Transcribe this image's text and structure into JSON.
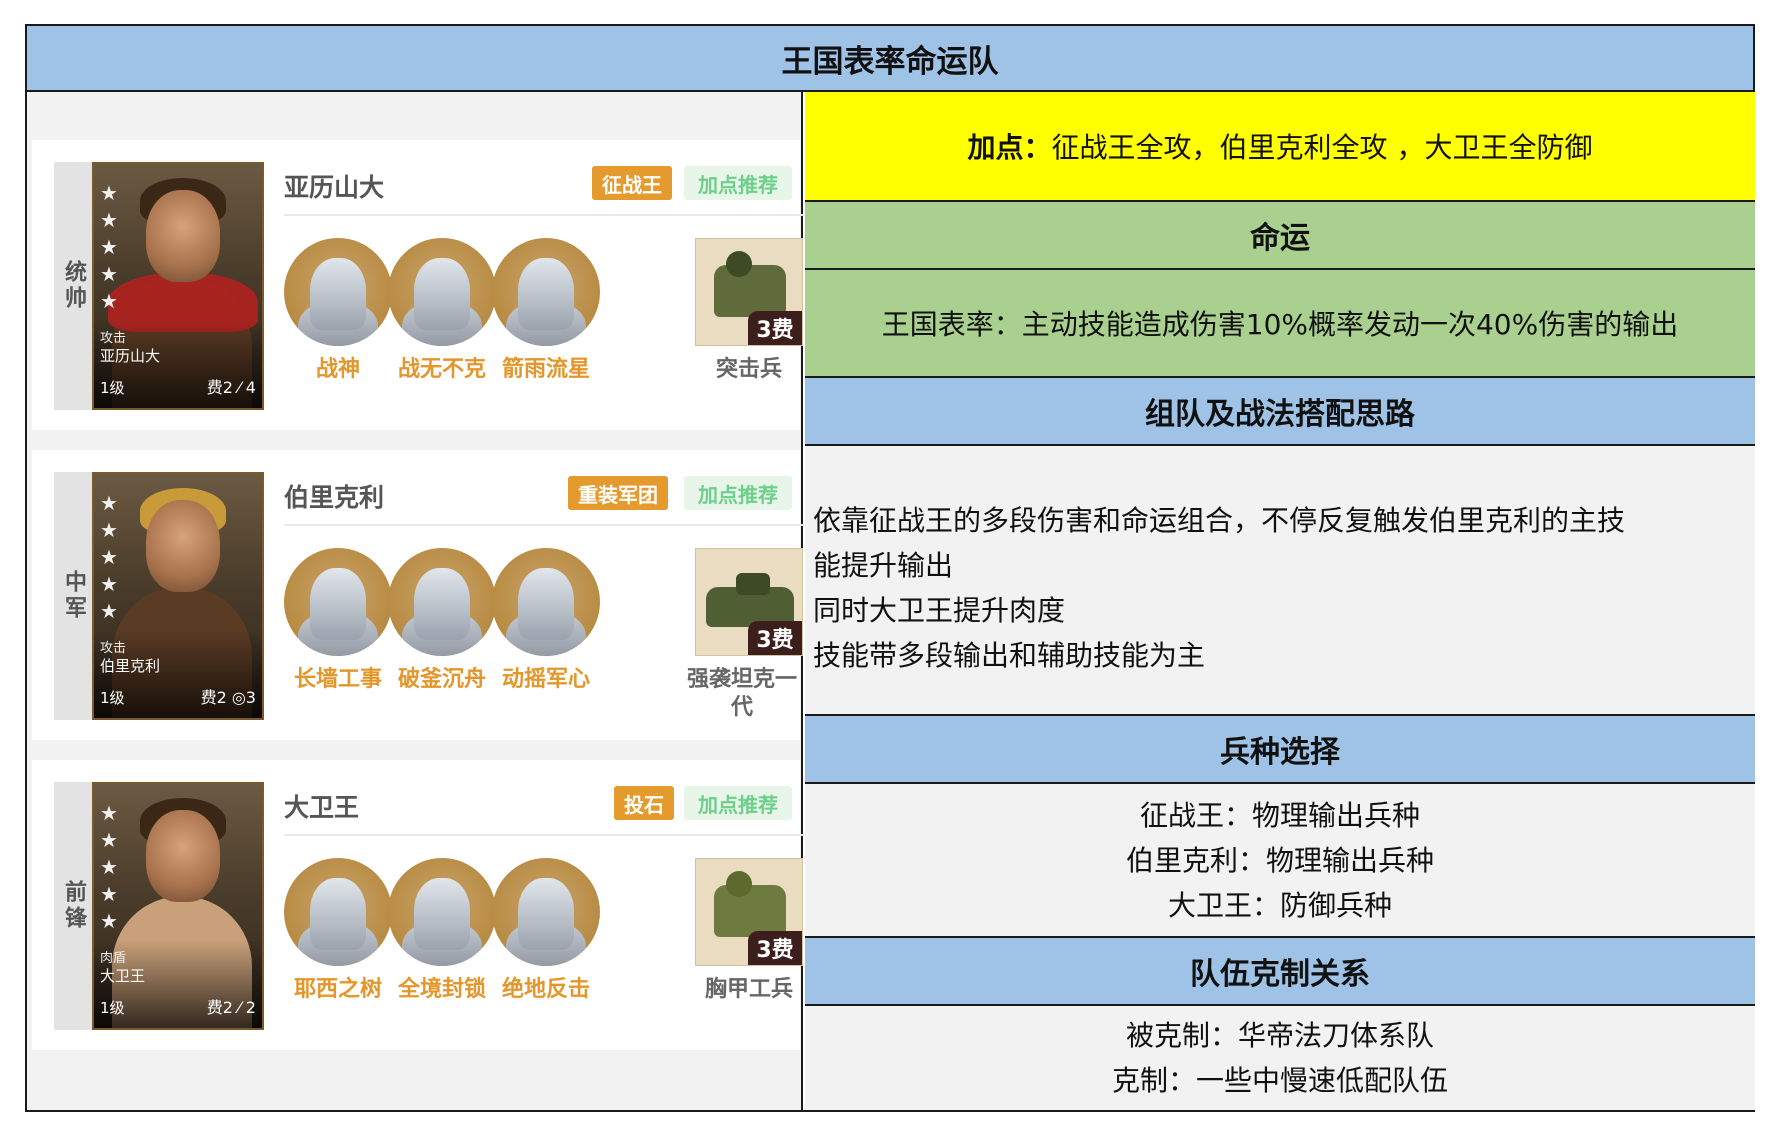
{
  "title": "王国表率命运队",
  "heroes": [
    {
      "position": "统帅",
      "name": "亚历山大",
      "tag": "征战王",
      "recommend": "加点推荐",
      "card_role": "攻击",
      "card_name": "亚历山大",
      "level": "1级",
      "cost": "费2 ⁄ 4",
      "skills": [
        "战神",
        "战无不克",
        "箭雨流星"
      ],
      "troop": "突击兵",
      "troop_fee": "3费"
    },
    {
      "position": "中军",
      "name": "伯里克利",
      "tag": "重装军团",
      "recommend": "加点推荐",
      "card_role": "攻击",
      "card_name": "伯里克利",
      "level": "1级",
      "cost": "费2 ◎3",
      "skills": [
        "长墙工事",
        "破釜沉舟",
        "动摇军心"
      ],
      "troop": "强袭坦克一代",
      "troop_fee": "3费"
    },
    {
      "position": "前锋",
      "name": "大卫王",
      "tag": "投石",
      "recommend": "加点推荐",
      "card_role": "肉盾",
      "card_name": "大卫王",
      "level": "1级",
      "cost": "费2 ⁄ 2",
      "skills": [
        "耶西之树",
        "全境封锁",
        "绝地反击"
      ],
      "troop": "胸甲工兵",
      "troop_fee": "3费"
    }
  ],
  "right": {
    "points_label": "加点：",
    "points_text": "征战王全攻，伯里克利全攻 ，大卫王全防御",
    "fate_header": "命运",
    "fate_text": "王国表率：主动技能造成伤害10%概率发动一次40%伤害的输出",
    "ideas_header": "组队及战法搭配思路",
    "ideas_lines": [
      "依靠征战王的多段伤害和命运组合，不停反复触发伯里克利的主技",
      "能提升输出",
      "同时大卫王提升肉度",
      "技能带多段输出和辅助技能为主"
    ],
    "troops_header": "兵种选择",
    "troops_lines": [
      "征战王：物理输出兵种",
      "伯里克利：物理输出兵种",
      "大卫王：防御兵种"
    ],
    "counter_header": "队伍克制关系",
    "counter_lines": [
      "被克制：华帝法刀体系队",
      "克制：一些中慢速低配队伍"
    ]
  }
}
